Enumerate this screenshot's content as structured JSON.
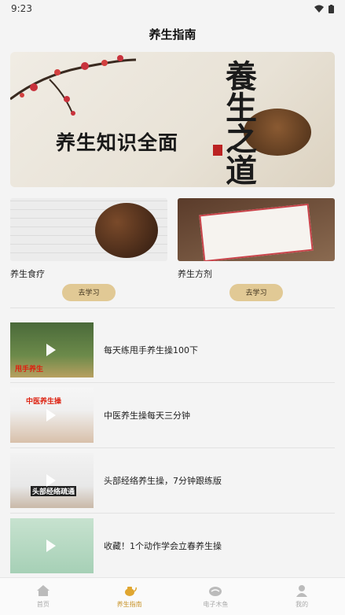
{
  "status": {
    "time": "9:23"
  },
  "header": {
    "title": "养生指南"
  },
  "banner": {
    "title": "养生知识全面",
    "calligraphy": "養生之道"
  },
  "cards": [
    {
      "label": "养生食疗",
      "button": "去学习"
    },
    {
      "label": "养生方剂",
      "button": "去学习"
    }
  ],
  "videos": [
    {
      "title": "每天练甩手养生操100下",
      "caption": "甩手养生"
    },
    {
      "title": "中医养生操每天三分钟",
      "caption": "中医养生操"
    },
    {
      "title": "头部经络养生操，7分钟跟练版",
      "caption": "头部经络疏通"
    },
    {
      "title": "收藏！1个动作学会立春养生操",
      "caption": ""
    }
  ],
  "tabbar": [
    {
      "label": "首页",
      "icon": "home-icon",
      "active": false
    },
    {
      "label": "养生指南",
      "icon": "teapot-icon",
      "active": true
    },
    {
      "label": "电子木鱼",
      "icon": "woodfish-icon",
      "active": false
    },
    {
      "label": "我的",
      "icon": "user-icon",
      "active": false
    }
  ],
  "colors": {
    "accent": "#c9952c",
    "button": "#e1c995"
  }
}
